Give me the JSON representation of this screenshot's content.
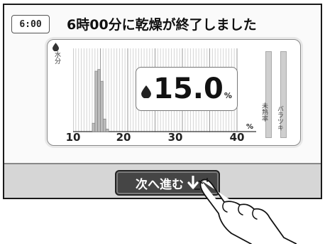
{
  "header": {
    "time": "6:00",
    "title": "6時00分に乾燥が終了しました"
  },
  "chart": {
    "axis_label": "水分",
    "tick_labels": [
      "10",
      "20",
      "30",
      "40"
    ],
    "unit": "%",
    "readout_value": "15.0",
    "readout_unit": "%",
    "meter_labels": [
      "未熟率",
      "バラツキ"
    ]
  },
  "chart_data": {
    "type": "bar",
    "xlim": [
      10,
      40
    ],
    "x": [
      13.5,
      14,
      14.5,
      15,
      15.5,
      16
    ],
    "values": [
      0.1,
      0.72,
      0.74,
      0.6,
      0.15,
      0.03
    ],
    "grid": true
  },
  "footer": {
    "next_label": "次へ進む"
  },
  "icons": [
    "drop-icon",
    "arrow-down-icon",
    "hand-pointer-icon"
  ],
  "colors": {
    "button_bg": "#454545",
    "bar_fill": "#bdbdbd",
    "meter_fill": "#cfcfcf"
  }
}
